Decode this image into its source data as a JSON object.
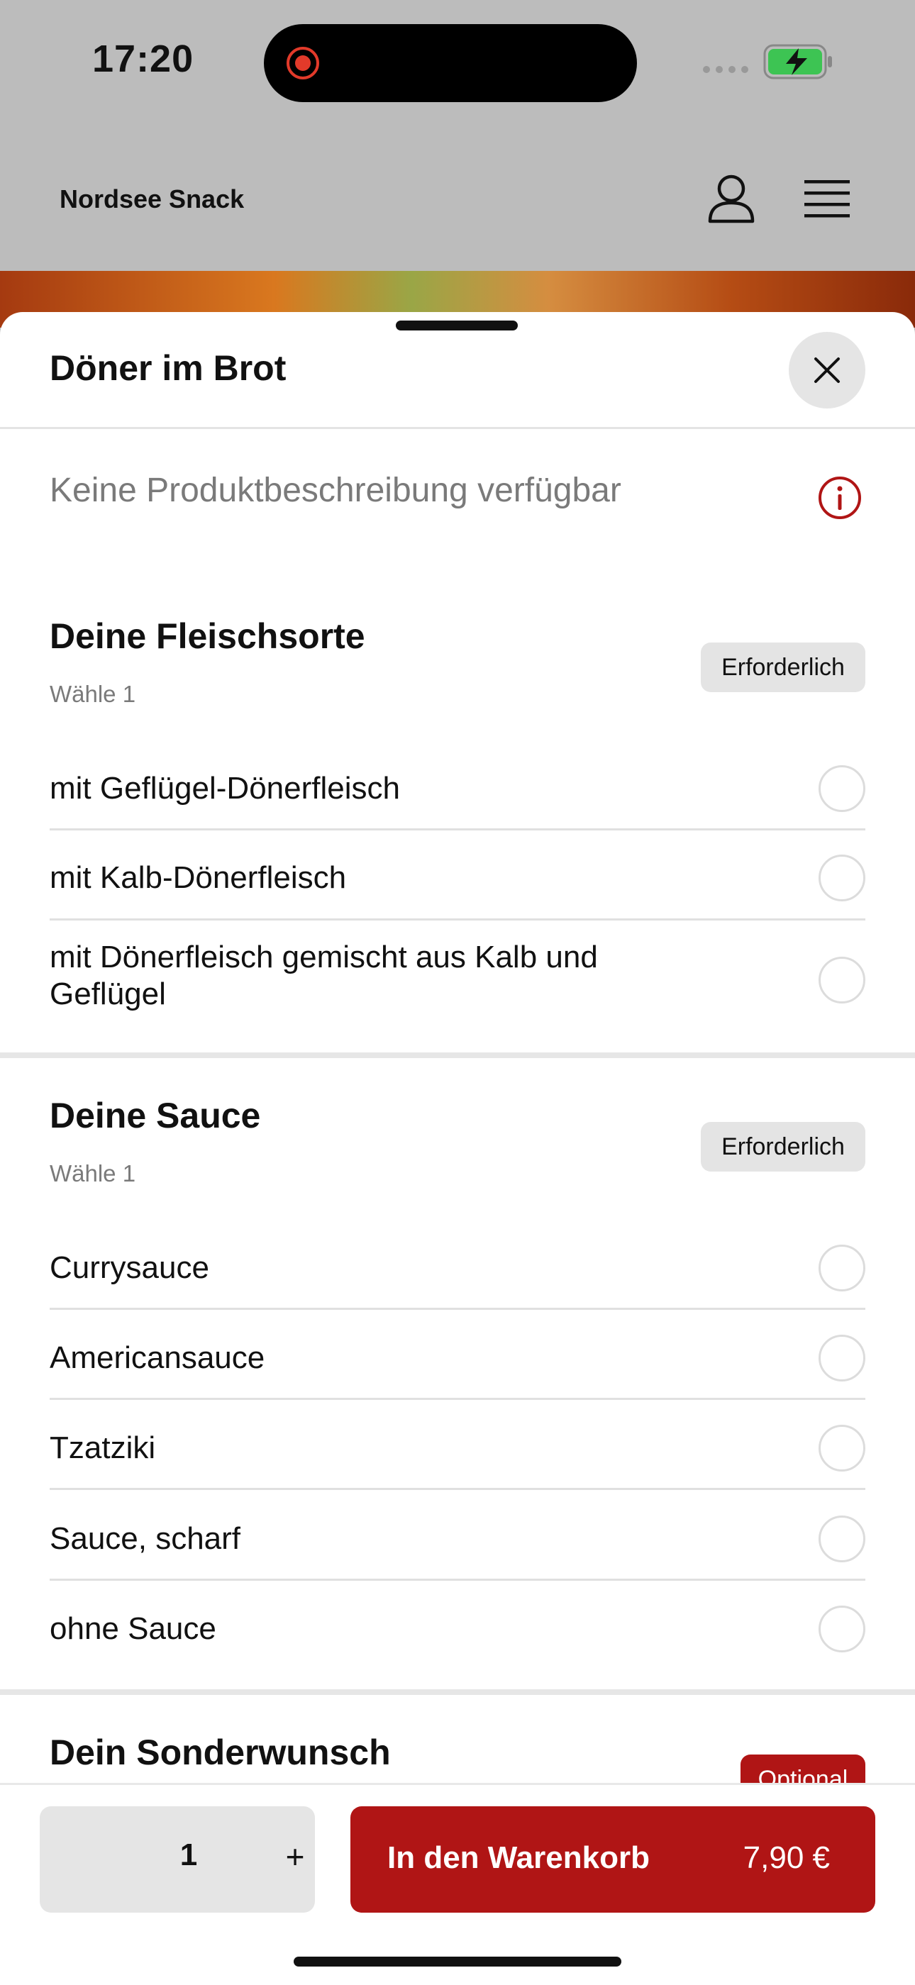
{
  "status_bar": {
    "time": "17:20"
  },
  "header": {
    "brand": "Nordsee Snack"
  },
  "sheet": {
    "title": "Döner im Brot",
    "description": "Keine Produktbeschreibung verfügbar"
  },
  "groups": [
    {
      "title": "Deine Fleischsorte",
      "subtitle": "Wähle 1",
      "badge": "Erforderlich",
      "options": [
        {
          "label": "mit Geflügel-Dönerfleisch"
        },
        {
          "label": "mit Kalb-Dönerfleisch"
        },
        {
          "label": "mit Dönerfleisch gemischt aus Kalb und Geflügel"
        }
      ]
    },
    {
      "title": "Deine Sauce",
      "subtitle": "Wähle 1",
      "badge": "Erforderlich",
      "options": [
        {
          "label": "Currysauce"
        },
        {
          "label": "Americansauce"
        },
        {
          "label": "Tzatziki"
        },
        {
          "label": "Sauce, scharf"
        },
        {
          "label": "ohne Sauce"
        }
      ]
    },
    {
      "title": "Dein Sonderwunsch",
      "badge": "Optional"
    }
  ],
  "bottom": {
    "quantity": "1",
    "plus": "+",
    "cart_label": "In den Warenkorb",
    "price": "7,90 €"
  },
  "colors": {
    "accent": "#b01515",
    "badge_bg": "#e4e4e4"
  }
}
